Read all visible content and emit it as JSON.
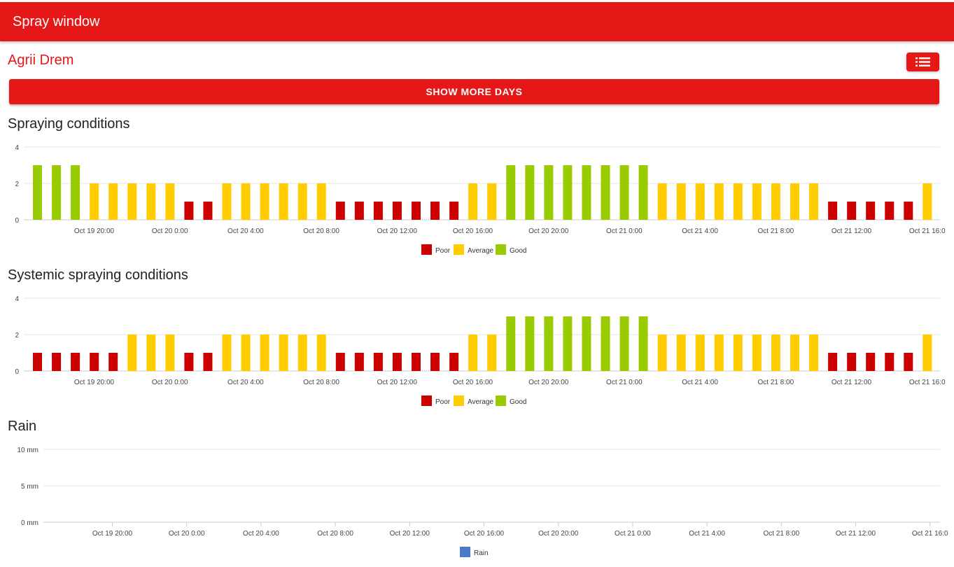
{
  "header": {
    "title": "Spray window"
  },
  "farm": {
    "name": "Agrii Drem"
  },
  "menu_button": {
    "icon": "list-icon"
  },
  "show_more": {
    "label": "SHOW MORE DAYS"
  },
  "colors": {
    "brand": "#e61717",
    "poor": "#cc0000",
    "average": "#ffcc00",
    "good": "#99cc00",
    "rain": "#4d79c9"
  },
  "sections": {
    "spraying": {
      "title": "Spraying conditions"
    },
    "systemic": {
      "title": "Systemic spraying conditions"
    },
    "rain": {
      "title": "Rain"
    }
  },
  "chart_data": [
    {
      "type": "bar",
      "title": "Spraying conditions",
      "ylim": [
        0,
        4
      ],
      "yticks": [
        "0",
        "2",
        "4"
      ],
      "xticks": [
        "Oct 19 20:00",
        "Oct 20 0:00",
        "Oct 20 4:00",
        "Oct 20 8:00",
        "Oct 20 12:00",
        "Oct 20 16:00",
        "Oct 20 20:00",
        "Oct 21 0:00",
        "Oct 21 4:00",
        "Oct 21 8:00",
        "Oct 21 12:00",
        "Oct 21 16:0"
      ],
      "values": [
        3,
        3,
        3,
        2,
        2,
        2,
        2,
        2,
        1,
        1,
        2,
        2,
        2,
        2,
        2,
        2,
        1,
        1,
        1,
        1,
        1,
        1,
        1,
        2,
        2,
        3,
        3,
        3,
        3,
        3,
        3,
        3,
        3,
        2,
        2,
        2,
        2,
        2,
        2,
        2,
        2,
        2,
        1,
        1,
        1,
        1,
        1,
        2
      ],
      "legend": [
        "Poor",
        "Average",
        "Good"
      ],
      "legend_position": "bottom",
      "grid": true
    },
    {
      "type": "bar",
      "title": "Systemic spraying conditions",
      "ylim": [
        0,
        4
      ],
      "yticks": [
        "0",
        "2",
        "4"
      ],
      "xticks": [
        "Oct 19 20:00",
        "Oct 20 0:00",
        "Oct 20 4:00",
        "Oct 20 8:00",
        "Oct 20 12:00",
        "Oct 20 16:00",
        "Oct 20 20:00",
        "Oct 21 0:00",
        "Oct 21 4:00",
        "Oct 21 8:00",
        "Oct 21 12:00",
        "Oct 21 16:0"
      ],
      "values": [
        1,
        1,
        1,
        1,
        1,
        2,
        2,
        2,
        1,
        1,
        2,
        2,
        2,
        2,
        2,
        2,
        1,
        1,
        1,
        1,
        1,
        1,
        1,
        2,
        2,
        3,
        3,
        3,
        3,
        3,
        3,
        3,
        3,
        2,
        2,
        2,
        2,
        2,
        2,
        2,
        2,
        2,
        1,
        1,
        1,
        1,
        1,
        2
      ],
      "legend": [
        "Poor",
        "Average",
        "Good"
      ],
      "legend_position": "bottom",
      "grid": true
    },
    {
      "type": "bar",
      "title": "Rain",
      "ylim": [
        0,
        10
      ],
      "yticks": [
        "0 mm",
        "5 mm",
        "10 mm"
      ],
      "xticks": [
        "Oct 19 20:00",
        "Oct 20 0:00",
        "Oct 20 4:00",
        "Oct 20 8:00",
        "Oct 20 12:00",
        "Oct 20 16:00",
        "Oct 20 20:00",
        "Oct 21 0:00",
        "Oct 21 4:00",
        "Oct 21 8:00",
        "Oct 21 12:00",
        "Oct 21 16:0"
      ],
      "values": [],
      "legend": [
        "Rain"
      ],
      "legend_position": "bottom",
      "grid": true
    }
  ]
}
